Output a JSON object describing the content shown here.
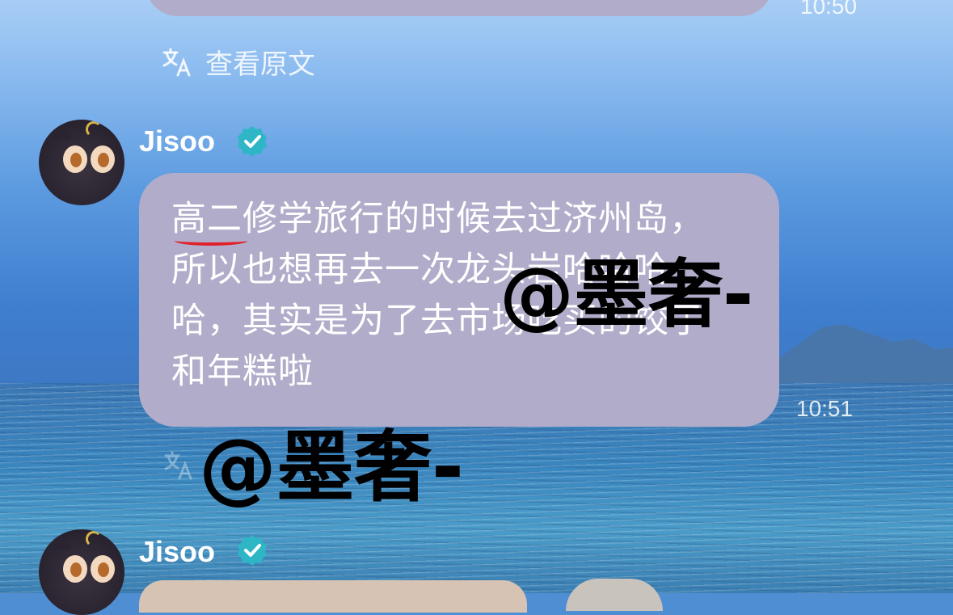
{
  "messages": [
    {
      "time": "10:50",
      "translate_label": "查看原文"
    },
    {
      "sender": "Jisoo",
      "verified": true,
      "lines": [
        "高二修学旅行的时候去过济州岛，",
        "所以也想再去一次龙头岩哈哈哈",
        "哈，其实是为了去市场吃买的饺子",
        "和年糕啦"
      ],
      "time": "10:51"
    },
    {
      "sender": "Jisoo",
      "verified": true
    }
  ],
  "watermarks": [
    "@墨奢-",
    "@墨奢-"
  ],
  "icons": {
    "translate": "translate-icon",
    "verified": "verified-badge-icon",
    "avatar": "avatar-black-cat"
  },
  "colors": {
    "bubble": "#b1acc9",
    "verified": "#2fb6c6",
    "underline": "#e0202a"
  }
}
